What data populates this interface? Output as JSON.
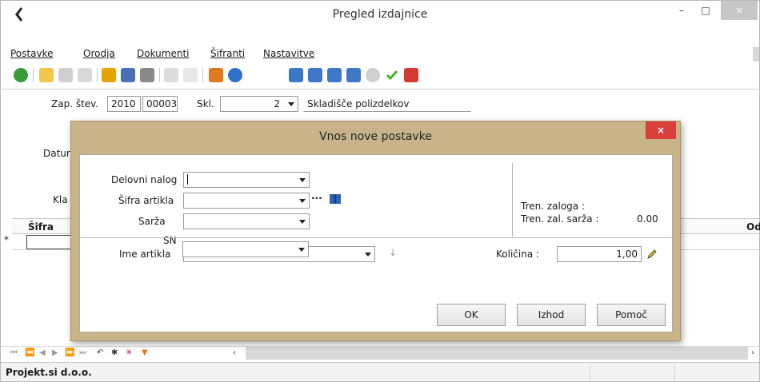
{
  "window": {
    "title": "Pregled izdajnice",
    "minimize": "–",
    "maximize": "□",
    "close": "×"
  },
  "menu": [
    "Postavke",
    "Orodja",
    "Dokumenti",
    "Šifranti",
    "Nastavitve"
  ],
  "form": {
    "zap_label": "Zap. štev.",
    "zap_year": "2010",
    "zap_num": "00003",
    "skl_label": "Skl.",
    "skl_value": "2",
    "skl_name": "Skladišče polizdelkov",
    "datum_label": "Datur",
    "kla_label": "Kla"
  },
  "grid": {
    "col_sifra": "Šifra",
    "col_od": "Od",
    "row_indicator": "*"
  },
  "status": {
    "company": "Projekt.si d.o.o."
  },
  "dialog": {
    "title": "Vnos nove postavke",
    "close": "×",
    "fields": {
      "delovni_nalog": "Delovni nalog",
      "sifra_artikla": "Šifra artikla",
      "sarza": "Sarža",
      "sn": "SN",
      "ime_artikla": "Ime artikla",
      "ellipsis": "···"
    },
    "info": {
      "tren_zaloga": "Tren. zaloga :",
      "tren_zal_sarza": "Tren. zal. sarža :",
      "tren_zal_sarza_value": "0.00",
      "kolicina_label": "Količina :",
      "kolicina_value": "1,00"
    },
    "buttons": {
      "ok": "OK",
      "izhod": "Izhod",
      "pomoc": "Pomoč"
    }
  }
}
